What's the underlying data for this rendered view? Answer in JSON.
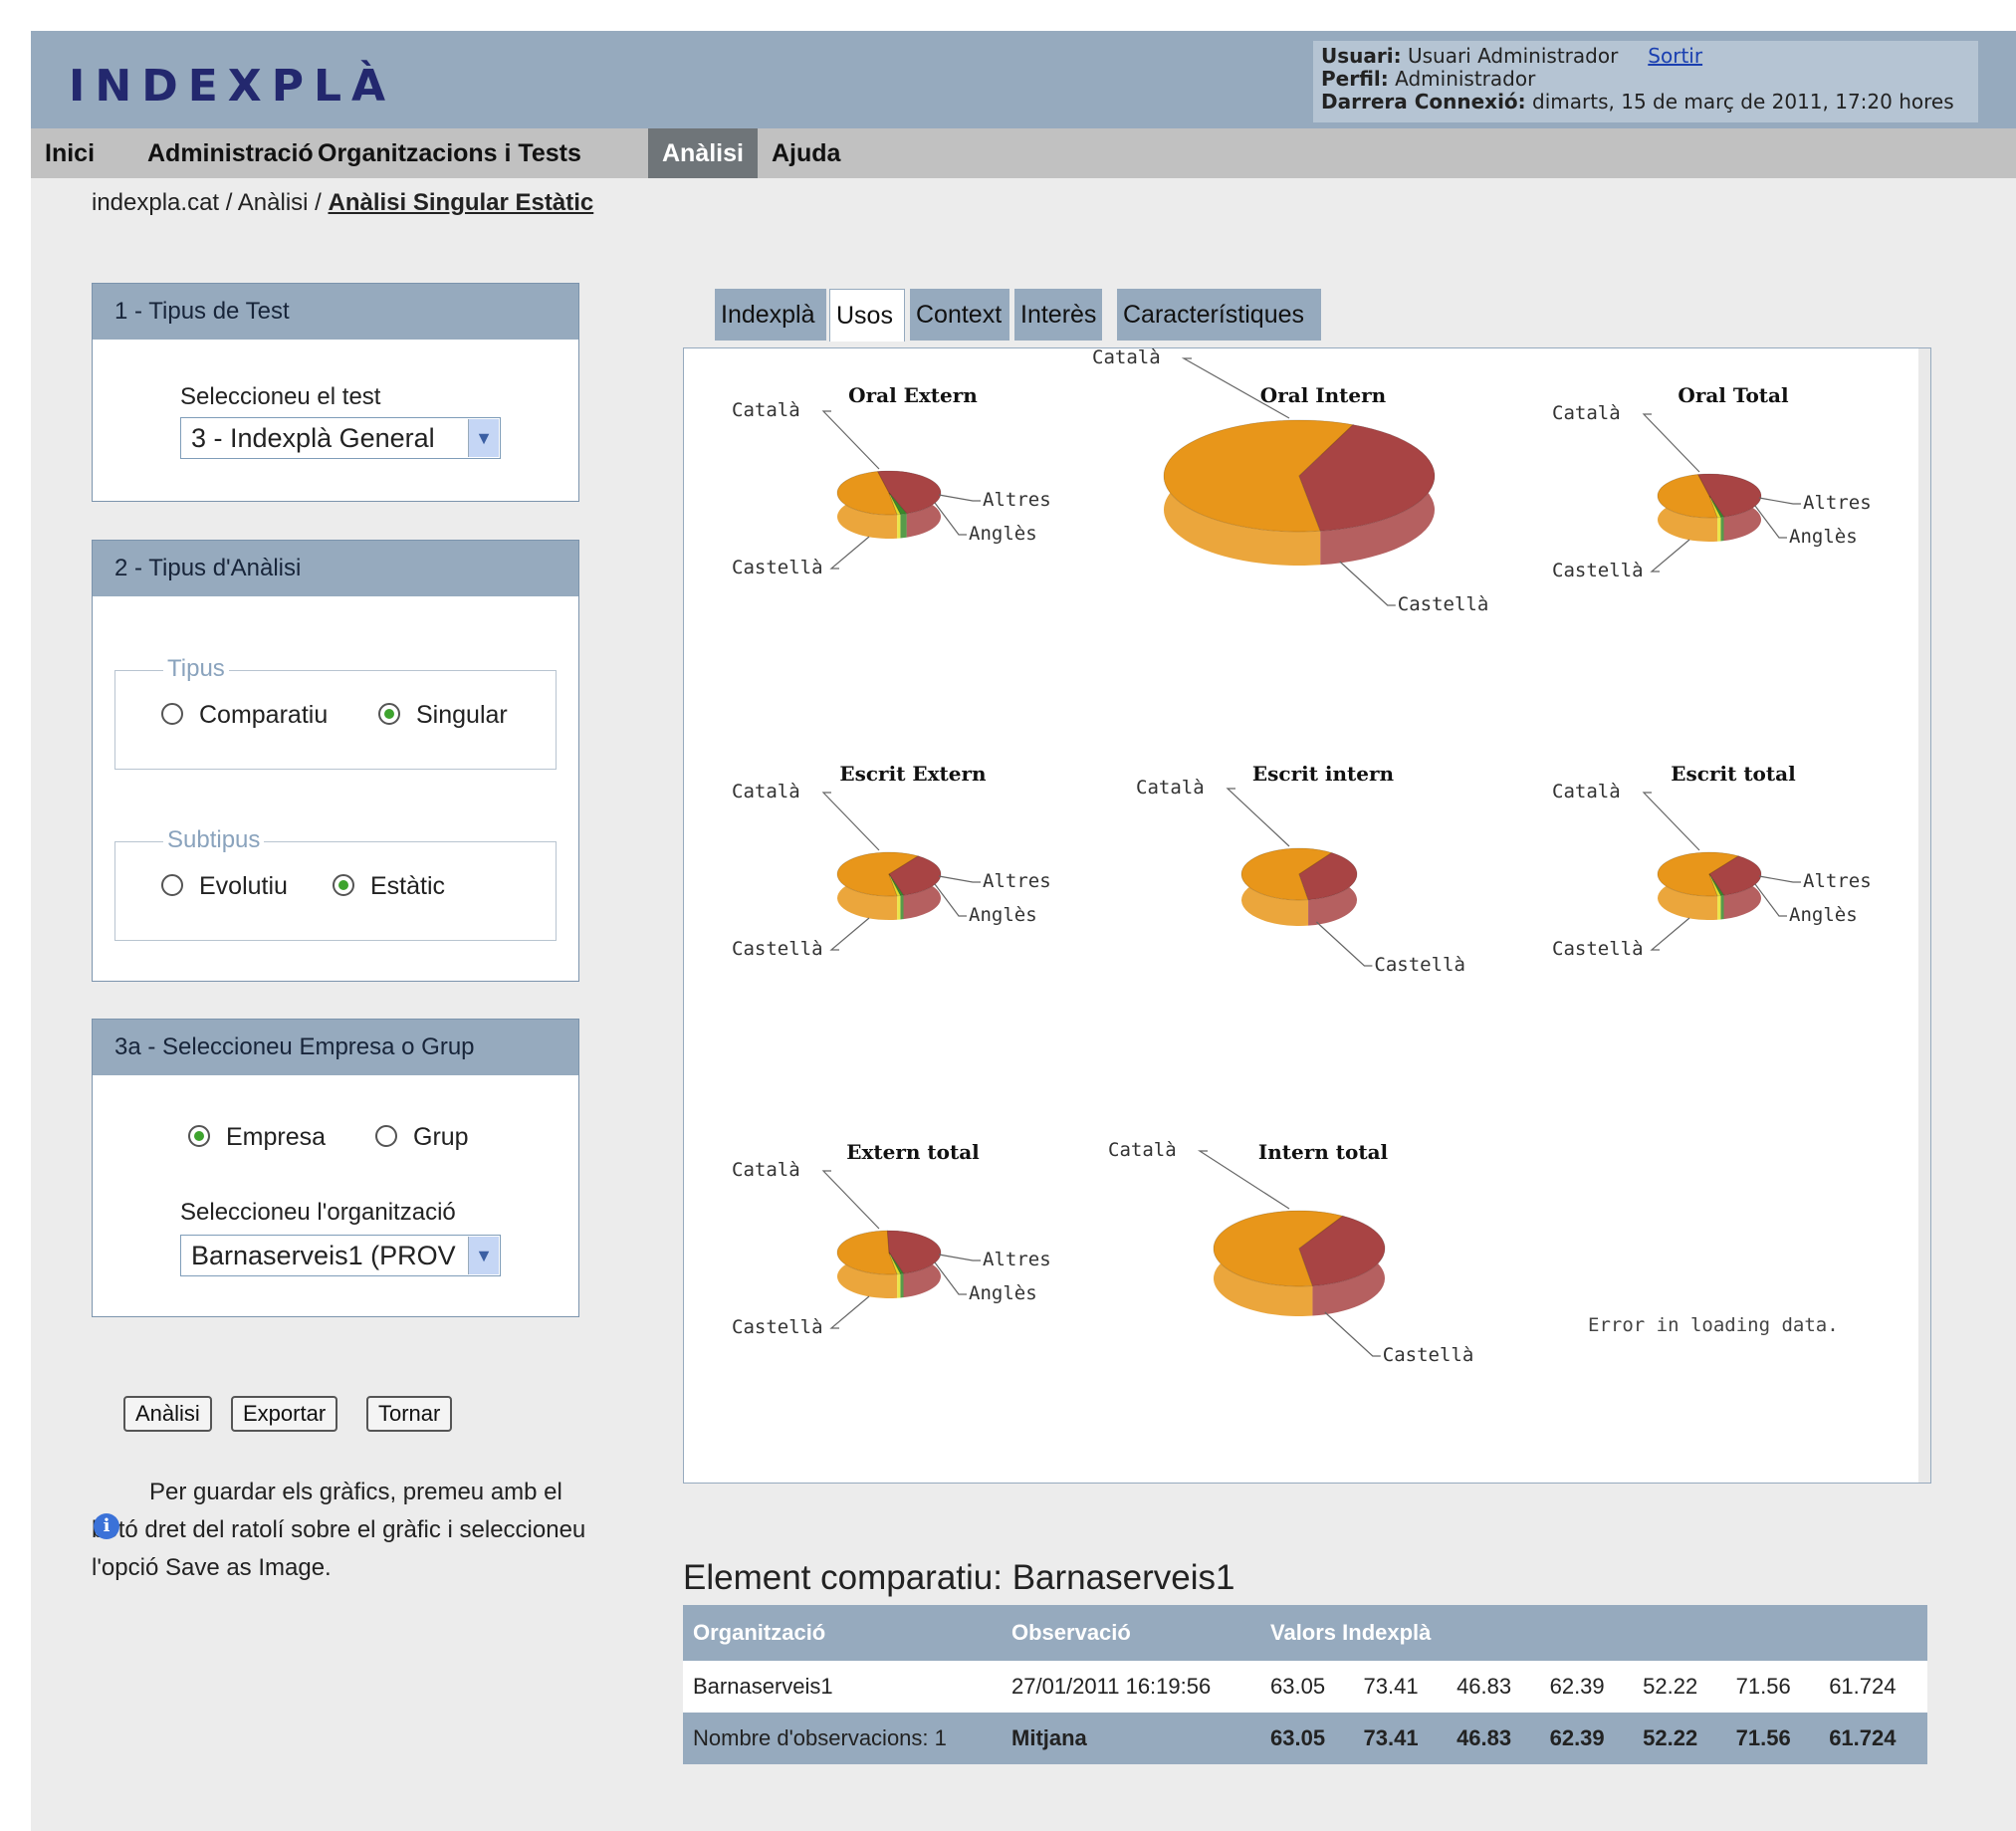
{
  "app": {
    "logo": "INDEXPLÀ"
  },
  "user": {
    "usuari_label": "Usuari:",
    "usuari_value": "Usuari Administrador",
    "sortir": "Sortir",
    "perfil_label": "Perfil:",
    "perfil_value": "Administrador",
    "connexio_label": "Darrera Connexió:",
    "connexio_value": "dimarts, 15 de març de 2011, 17:20 hores"
  },
  "menu": {
    "items": [
      "Inici",
      "Administració",
      "Organitzacions i Tests",
      "Anàlisi",
      "Ajuda"
    ],
    "active": "Anàlisi"
  },
  "breadcrumb": {
    "home": "indexpla.cat",
    "sep": " / ",
    "section": "Anàlisi",
    "current": "Anàlisi Singular Estàtic"
  },
  "panel1": {
    "title": "1 - Tipus de Test",
    "label": "Seleccioneu el test",
    "select_value": "3 - Indexplà General"
  },
  "panel2": {
    "title": "2 - Tipus d'Anàlisi",
    "tipus_legend": "Tipus",
    "comparatiu": "Comparatiu",
    "singular": "Singular",
    "tipus_selected": "Singular",
    "subtipus_legend": "Subtipus",
    "evolutiu": "Evolutiu",
    "estatic": "Estàtic",
    "subtipus_selected": "Estàtic"
  },
  "panel3": {
    "title": "3a - Seleccioneu Empresa o Grup",
    "empresa": "Empresa",
    "grup": "Grup",
    "selected": "Empresa",
    "org_label": "Seleccioneu l'organització",
    "org_value": "Barnaserveis1 (PROV"
  },
  "buttons": {
    "analisi": "Anàlisi",
    "exportar": "Exportar",
    "tornar": "Tornar"
  },
  "info": {
    "text": "Per guardar els gràfics, premeu amb el botó dret del ratolí sobre el gràfic i seleccioneu l'opció Save as Image."
  },
  "tabs": [
    "Indexplà",
    "Usos",
    "Context",
    "Interès",
    "Característiques"
  ],
  "active_tab": "Usos",
  "colors": {
    "catala": "#e8961a",
    "castella": "#a84444",
    "altres": "#3a8a2a",
    "angles": "#e8e02a",
    "header": "#96aabe",
    "accent": "#6f7579"
  },
  "chart_labels": {
    "catala": "Català",
    "castella": "Castellà",
    "altres": "Altres",
    "angles": "Anglès"
  },
  "chart_data": [
    {
      "type": "pie",
      "title": "Oral Extern",
      "categories": [
        "Català",
        "Castellà",
        "Altres",
        "Anglès"
      ],
      "values": [
        49,
        48,
        2,
        1
      ]
    },
    {
      "type": "pie",
      "title": "Oral Intern",
      "categories": [
        "Català",
        "Castellà"
      ],
      "values": [
        59,
        41
      ]
    },
    {
      "type": "pie",
      "title": "Oral Total",
      "categories": [
        "Català",
        "Castellà",
        "Altres",
        "Anglès"
      ],
      "values": [
        49,
        49,
        1,
        1
      ]
    },
    {
      "type": "pie",
      "title": "Escrit Extern",
      "categories": [
        "Català",
        "Castellà",
        "Altres",
        "Anglès"
      ],
      "values": [
        62,
        36,
        1,
        1
      ]
    },
    {
      "type": "pie",
      "title": "Escrit intern",
      "categories": [
        "Català",
        "Castellà"
      ],
      "values": [
        62,
        38
      ]
    },
    {
      "type": "pie",
      "title": "Escrit total",
      "categories": [
        "Català",
        "Castellà",
        "Altres",
        "Anglès"
      ],
      "values": [
        62,
        36,
        1,
        1
      ]
    },
    {
      "type": "pie",
      "title": "Extern total",
      "categories": [
        "Català",
        "Castellà",
        "Altres",
        "Anglès"
      ],
      "values": [
        52,
        46,
        1,
        1
      ]
    },
    {
      "type": "pie",
      "title": "Intern total",
      "categories": [
        "Català",
        "Castellà"
      ],
      "values": [
        61,
        39
      ]
    }
  ],
  "chart_error": "Error in loading data.",
  "element": {
    "title": "Element comparatiu: Barnaserveis1"
  },
  "table": {
    "headers": [
      "Organització",
      "Observació",
      "Valors Indexplà"
    ],
    "row": [
      "Barnaserveis1",
      "27/01/2011 16:19:56",
      "63.05",
      "73.41",
      "46.83",
      "62.39",
      "52.22",
      "71.56",
      "61.724"
    ],
    "footer": [
      "Nombre d'observacions: 1",
      "Mitjana",
      "63.05",
      "73.41",
      "46.83",
      "62.39",
      "52.22",
      "71.56",
      "61.724"
    ]
  }
}
